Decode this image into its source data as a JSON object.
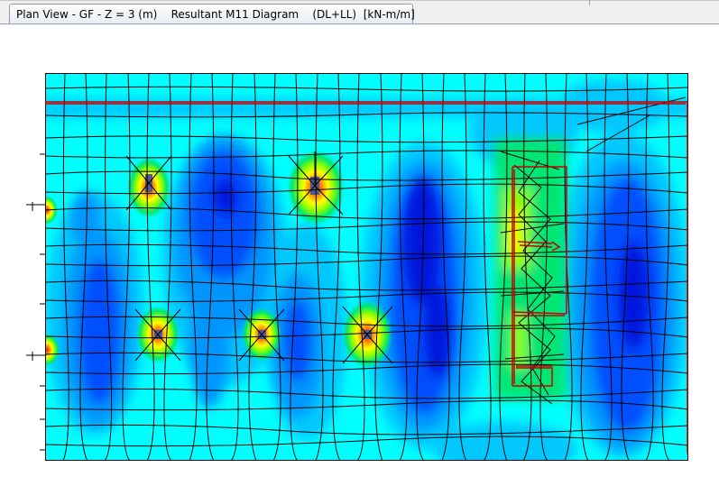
{
  "tab": {
    "title": "Plan View - GF - Z = 3 (m)    Resultant M11 Diagram    (DL+LL)  [kN-m/m]",
    "icon": "plan-view-icon"
  },
  "colors": {
    "background": "#00ffff",
    "mid": "#00c8ff",
    "light_blue": "#0096ff",
    "blue": "#0050ff",
    "deep_blue": "#0014dc",
    "green": "#00e673",
    "lime": "#8cff00",
    "yellow": "#ffff00",
    "orange": "#ff8c00",
    "red": "#ff1400",
    "mesh": "#000000",
    "boundary": "#c80000"
  }
}
